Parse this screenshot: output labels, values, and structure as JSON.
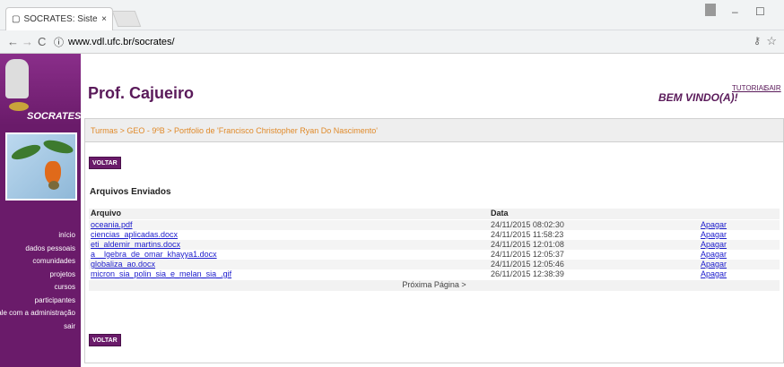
{
  "browser": {
    "tab_title": "SÓCRATES: Sistema Onli",
    "tab_close": "×",
    "url": "www.vdl.ufc.br/socrates/",
    "back": "←",
    "forward": "→",
    "reload": "C",
    "info": "ⓘ",
    "star": "☆",
    "key": "⚷",
    "minimize": "–",
    "maximize": "☐"
  },
  "sidebar": {
    "logo_text": "SOCRATES",
    "menu": [
      {
        "label": "início"
      },
      {
        "label": "dados pessoais"
      },
      {
        "label": "comunidades"
      },
      {
        "label": "projetos"
      },
      {
        "label": "cursos"
      },
      {
        "label": "participantes"
      },
      {
        "label": "fale com a administração"
      },
      {
        "label": "sair"
      }
    ]
  },
  "header": {
    "title": "Prof. Cajueiro",
    "welcome": "BEM VINDO(A)!",
    "tutorial": "TUTORIAL",
    "sair": "SAIR"
  },
  "main": {
    "breadcrumb": "Turmas > GEO - 9ºB > Portfolio de 'Francisco Christopher Ryan Do Nascimento'",
    "back_top": "VOLTAR",
    "back_bottom": "VOLTAR",
    "section_title": "Arquivos Enviados",
    "columns": {
      "file": "Arquivo",
      "date": "Data"
    },
    "rows": [
      {
        "file": "oceania.pdf",
        "date": "24/11/2015 08:02:30",
        "action": "Apagar"
      },
      {
        "file": "ciencias_aplicadas.docx",
        "date": "24/11/2015 11:58:23",
        "action": "Apagar"
      },
      {
        "file": "eti_aldemir_martins.docx",
        "date": "24/11/2015 12:01:08",
        "action": "Apagar"
      },
      {
        "file": "a__lgebra_de_omar_khayya1.docx",
        "date": "24/11/2015 12:05:37",
        "action": "Apagar"
      },
      {
        "file": "globaliza_ao.docx",
        "date": "24/11/2015 12:05:46",
        "action": "Apagar"
      },
      {
        "file": "micron_sia_polin_sia_e_melan_sia_.gif",
        "date": "26/11/2015 12:38:39",
        "action": "Apagar"
      }
    ],
    "next_page": "Próxima Página >"
  }
}
